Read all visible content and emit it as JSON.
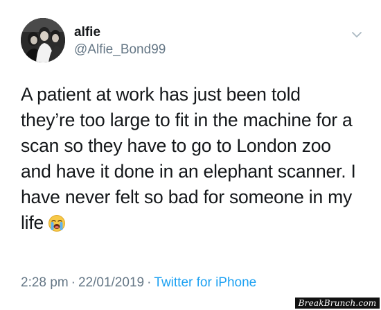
{
  "user": {
    "display_name": "alfie",
    "handle": "@Alfie_Bond99",
    "avatar_icon": "profile-photo"
  },
  "menu": {
    "icon": "chevron-down-icon"
  },
  "tweet": {
    "lines": [
      "A patient at work has just been told",
      "they’re too large to fit in the machine for a",
      "scan so they have to go to London zoo",
      "and have it done in an elephant scanner. I",
      "have never felt so bad for someone in my",
      "life"
    ],
    "emoji": "loudly-crying-face-icon"
  },
  "meta": {
    "time": "2:28 pm",
    "separator": "·",
    "date": "22/01/2019",
    "source": "Twitter for iPhone"
  },
  "watermark": "BreakBrunch.com",
  "colors": {
    "text": "#14171a",
    "muted": "#657786",
    "link": "#1da1f2",
    "background": "#ffffff"
  }
}
